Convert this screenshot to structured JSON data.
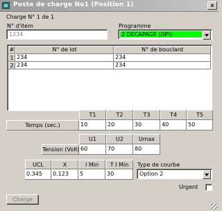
{
  "window": {
    "title": "Poste de charge No1 (Position 1)",
    "close_glyph": "×"
  },
  "header": {
    "charge_counter": "Charge N° 1 de 1"
  },
  "item": {
    "label": "N° d'item",
    "value": "1234"
  },
  "programme": {
    "label": "Programme",
    "selected": "2 DECAPAGE (OPI)",
    "highlight_color": "#00ff00"
  },
  "lot_table": {
    "headers": [
      "#",
      "N° de lot",
      "N° de bouclard"
    ],
    "rows": [
      {
        "num": "1",
        "lot": "234",
        "bouclard": "234"
      },
      {
        "num": "2",
        "lot": "234",
        "bouclard": "234"
      }
    ]
  },
  "temps": {
    "headers": [
      "T1",
      "T2",
      "T3",
      "T4",
      "T5"
    ],
    "label": "Temps (sec.)",
    "values": [
      "10",
      "20",
      "30",
      "40",
      "50"
    ]
  },
  "tension": {
    "headers": [
      "U1",
      "U2",
      "Umax"
    ],
    "label": "Tension (Volts)",
    "values": [
      "60",
      "70",
      "80"
    ]
  },
  "params": {
    "headers": [
      "UCL",
      "X",
      "I Min",
      "T I Min"
    ],
    "values": [
      "0.345",
      "0.123",
      "5",
      "30"
    ]
  },
  "courbe": {
    "label": "Type de courbe",
    "selected": "Option 2"
  },
  "urgent": {
    "label": "Urgent",
    "checked": false
  },
  "buttons": {
    "charge_label": "Charge"
  }
}
